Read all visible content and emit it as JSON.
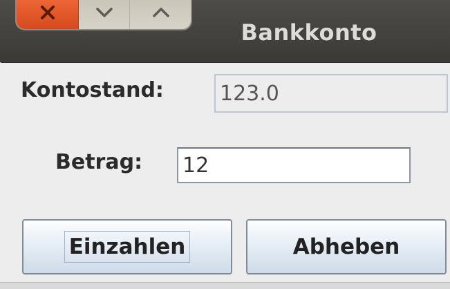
{
  "window": {
    "title": "Bankkonto",
    "controls": {
      "close_icon": "close-icon",
      "minimize_icon": "chevron-down-icon",
      "maximize_icon": "chevron-up-icon"
    }
  },
  "form": {
    "balance_label": "Kontostand:",
    "balance_value": "123.0",
    "amount_label": "Betrag:",
    "amount_value": "12"
  },
  "buttons": {
    "deposit_label": "Einzahlen",
    "withdraw_label": "Abheben"
  },
  "colors": {
    "close_button": "#e0572a",
    "titlebar": "#3c3b37",
    "title_text": "#dedcd6",
    "button_border": "#7f8c99"
  }
}
